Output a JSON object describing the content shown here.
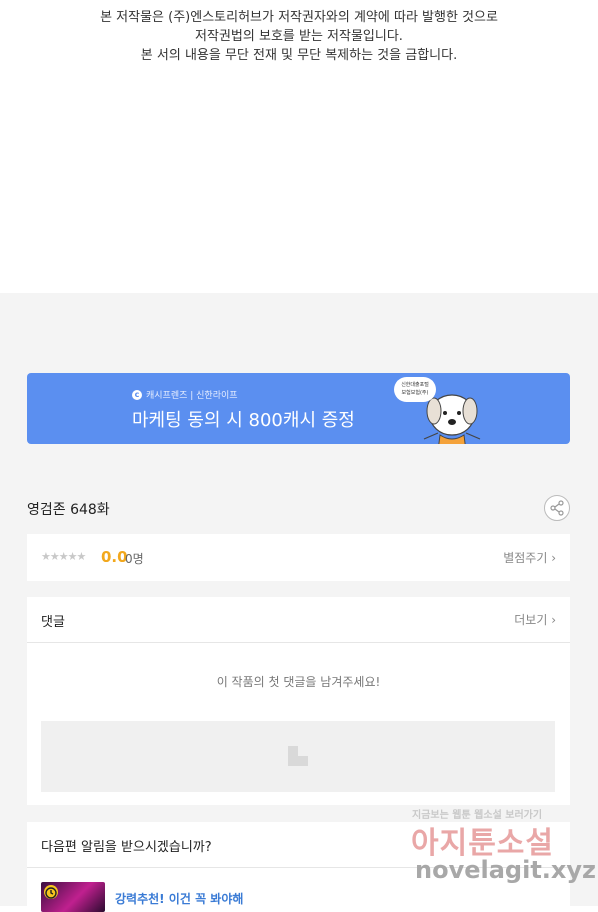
{
  "copyright": {
    "line1": "본 저작물은 (주)엔스토리허브가 저작권자와의 계약에 따라 발행한 것으로",
    "line2": "저작권법의 보호를 받는 저작물입니다.",
    "line3": "본 서의 내용을 무단 전재 및 무단 복제하는 것을 금합니다."
  },
  "banner": {
    "brand": "캐시프렌즈 | 신한라이프",
    "headline": "마케팅 동의 시 800캐시 증정",
    "bubble_line1": "신한대출포털",
    "bubble_line2": "보험보험(주)",
    "bg_color": "#5b8ff0"
  },
  "episode": {
    "title": "영검존 648화"
  },
  "rating": {
    "stars": "★★★★★",
    "score": "0.0",
    "count": "0명",
    "rate_label": "별점주기 ›",
    "score_color": "#f2a81d"
  },
  "comments": {
    "label": "댓글",
    "more_label": "더보기 ›",
    "empty_text": "이 작품의 첫 댓글을 남겨주세요!"
  },
  "notify": {
    "question": "다음편 알림을 받으시겠습니까?",
    "recommend": "강력추천! 이건 꼭 봐야해"
  },
  "watermark": {
    "top": "지금보는 웹툰 웹소설 보러가기",
    "mid": "아지툰소설",
    "bottom": "novelagit.xyz"
  },
  "icons": {
    "share": "share-icon",
    "clock": "clock-icon",
    "placeholder": "image-placeholder-icon"
  }
}
